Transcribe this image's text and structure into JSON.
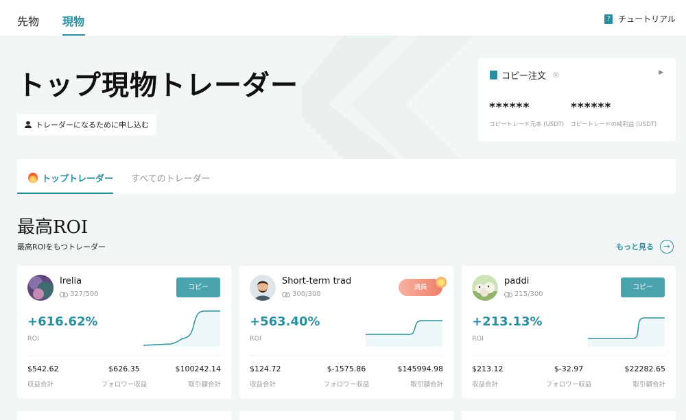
{
  "header": {
    "tabs": [
      {
        "label": "先物"
      },
      {
        "label": "現物"
      }
    ],
    "tutorial": "チュートリアル"
  },
  "hero": {
    "title": "トップ現物トレーダー",
    "apply_label": "トレーダーになるために申し込む"
  },
  "copy_order": {
    "title": "コピー注文",
    "values": [
      "******",
      "******"
    ],
    "labels": [
      "コピートレード元本 (USDT)",
      "コピートレードの純利益 (USDT)"
    ]
  },
  "trader_tabs": [
    {
      "label": "トップトレーダー"
    },
    {
      "label": "すべてのトレーダー"
    }
  ],
  "section": {
    "title": "最高ROI",
    "subtitle": "最高ROIをもつトレーダー",
    "more": "もっと見る"
  },
  "stat_labels": [
    "収益合計",
    "フォロワー収益",
    "取引額合計"
  ],
  "cards": [
    {
      "name": "Irelia",
      "followers": "327/500",
      "action": "コピー",
      "roi": "+616.62%",
      "roi_label": "ROI",
      "stats": [
        "$542.62",
        "$626.35",
        "$100242.14"
      ]
    },
    {
      "name": "Short-term trad",
      "followers": "300/300",
      "action": "満員",
      "roi": "+563.40%",
      "roi_label": "ROI",
      "stats": [
        "$124.72",
        "$-1575.86",
        "$145994.98"
      ]
    },
    {
      "name": "paddi",
      "followers": "215/300",
      "action": "コピー",
      "roi": "+213.13%",
      "roi_label": "ROI",
      "stats": [
        "$213.12",
        "$-32.97",
        "$22282.65"
      ]
    }
  ],
  "colors": {
    "accent": "#2a8fa0",
    "button": "#4ba3b0",
    "full_badge": "#ef7f6a",
    "background": "#f3f6f6"
  }
}
